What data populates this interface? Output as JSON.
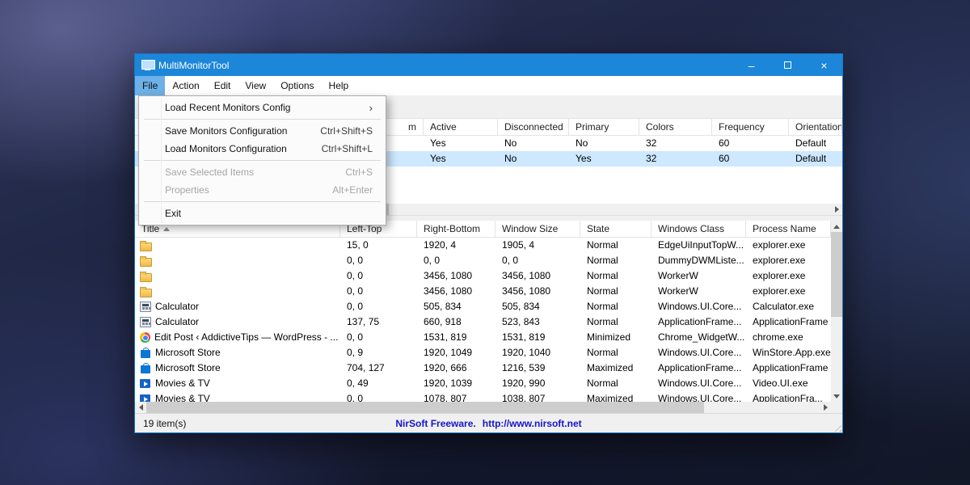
{
  "theme": {
    "titlebar": "#1c86d9",
    "window_border": "#1779c8",
    "menu_highlight": "#6cb1e7",
    "selection": "#cde8ff",
    "status_link": "#1515c8",
    "folder_yellow": "#f0b84a"
  },
  "window": {
    "title": "MultiMonitorTool",
    "controls": {
      "minimize": "–",
      "close": "×"
    }
  },
  "menu_bar": {
    "items": [
      {
        "label": "File"
      },
      {
        "label": "Action"
      },
      {
        "label": "Edit"
      },
      {
        "label": "View"
      },
      {
        "label": "Options"
      },
      {
        "label": "Help"
      }
    ]
  },
  "file_menu": {
    "load_recent": {
      "label": "Load Recent Monitors Config",
      "submenu_arrow": "›"
    },
    "save_monitors_config": {
      "label": "Save Monitors Configuration",
      "shortcut": "Ctrl+Shift+S"
    },
    "load_monitors_config": {
      "label": "Load Monitors Configuration",
      "shortcut": "Ctrl+Shift+L"
    },
    "save_selected_items": {
      "label": "Save Selected Items",
      "shortcut": "Ctrl+S"
    },
    "properties": {
      "label": "Properties",
      "shortcut": "Alt+Enter"
    },
    "exit": {
      "label": "Exit"
    }
  },
  "monitors_list": {
    "columns": {
      "clipped": "m",
      "active": "Active",
      "disconnected": "Disconnected",
      "primary": "Primary",
      "colors": "Colors",
      "frequency": "Frequency",
      "orientation": "Orientation"
    },
    "rows": [
      {
        "active": "Yes",
        "disconnected": "No",
        "primary": "No",
        "colors": "32",
        "frequency": "60",
        "orientation": "Default"
      },
      {
        "active": "Yes",
        "disconnected": "No",
        "primary": "Yes",
        "colors": "32",
        "frequency": "60",
        "orientation": "Default"
      }
    ]
  },
  "windows_list": {
    "columns": {
      "title": "Title",
      "left_top": "Left-Top",
      "right_bottom": "Right-Bottom",
      "window_size": "Window Size",
      "state": "State",
      "windows_class": "Windows Class",
      "process_name": "Process Name"
    },
    "rows": [
      {
        "icon": "folder",
        "title": "",
        "left_top": "15, 0",
        "right_bottom": "1920, 4",
        "window_size": "1905, 4",
        "state": "Normal",
        "windows_class": "EdgeUiInputTopW...",
        "process_name": "explorer.exe"
      },
      {
        "icon": "folder",
        "title": "",
        "left_top": "0, 0",
        "right_bottom": "0, 0",
        "window_size": "0, 0",
        "state": "Normal",
        "windows_class": "DummyDWMListe...",
        "process_name": "explorer.exe"
      },
      {
        "icon": "folder",
        "title": "",
        "left_top": "0, 0",
        "right_bottom": "3456, 1080",
        "window_size": "3456, 1080",
        "state": "Normal",
        "windows_class": "WorkerW",
        "process_name": "explorer.exe"
      },
      {
        "icon": "folder",
        "title": "",
        "left_top": "0, 0",
        "right_bottom": "3456, 1080",
        "window_size": "3456, 1080",
        "state": "Normal",
        "windows_class": "WorkerW",
        "process_name": "explorer.exe"
      },
      {
        "icon": "calculator",
        "title": "Calculator",
        "left_top": "0, 0",
        "right_bottom": "505, 834",
        "window_size": "505, 834",
        "state": "Normal",
        "windows_class": "Windows.UI.Core...",
        "process_name": "Calculator.exe"
      },
      {
        "icon": "calculator",
        "title": "Calculator",
        "left_top": "137, 75",
        "right_bottom": "660, 918",
        "window_size": "523, 843",
        "state": "Normal",
        "windows_class": "ApplicationFrame...",
        "process_name": "ApplicationFrame"
      },
      {
        "icon": "chrome",
        "title": "Edit Post ‹ AddictiveTips — WordPress - ...",
        "left_top": "0, 0",
        "right_bottom": "1531, 819",
        "window_size": "1531, 819",
        "state": "Minimized",
        "windows_class": "Chrome_WidgetW...",
        "process_name": "chrome.exe"
      },
      {
        "icon": "store",
        "title": "Microsoft Store",
        "left_top": "0, 9",
        "right_bottom": "1920, 1049",
        "window_size": "1920, 1040",
        "state": "Normal",
        "windows_class": "Windows.UI.Core...",
        "process_name": "WinStore.App.exe"
      },
      {
        "icon": "store",
        "title": "Microsoft Store",
        "left_top": "704, 127",
        "right_bottom": "1920, 666",
        "window_size": "1216, 539",
        "state": "Maximized",
        "windows_class": "ApplicationFrame...",
        "process_name": "ApplicationFrame"
      },
      {
        "icon": "movies",
        "title": "Movies & TV",
        "left_top": "0, 49",
        "right_bottom": "1920, 1039",
        "window_size": "1920, 990",
        "state": "Normal",
        "windows_class": "Windows.UI.Core...",
        "process_name": "Video.UI.exe"
      },
      {
        "icon": "movies",
        "title": "Movies & TV",
        "left_top": "0, 0",
        "right_bottom": "1078, 807",
        "window_size": "1038, 807",
        "state": "Maximized",
        "windows_class": "Windows.UI.Core...",
        "process_name": "ApplicationFra..."
      }
    ]
  },
  "status_bar": {
    "items_count": "19 item(s)",
    "freeware_label": "NirSoft Freeware.",
    "url": "http://www.nirsoft.net"
  }
}
